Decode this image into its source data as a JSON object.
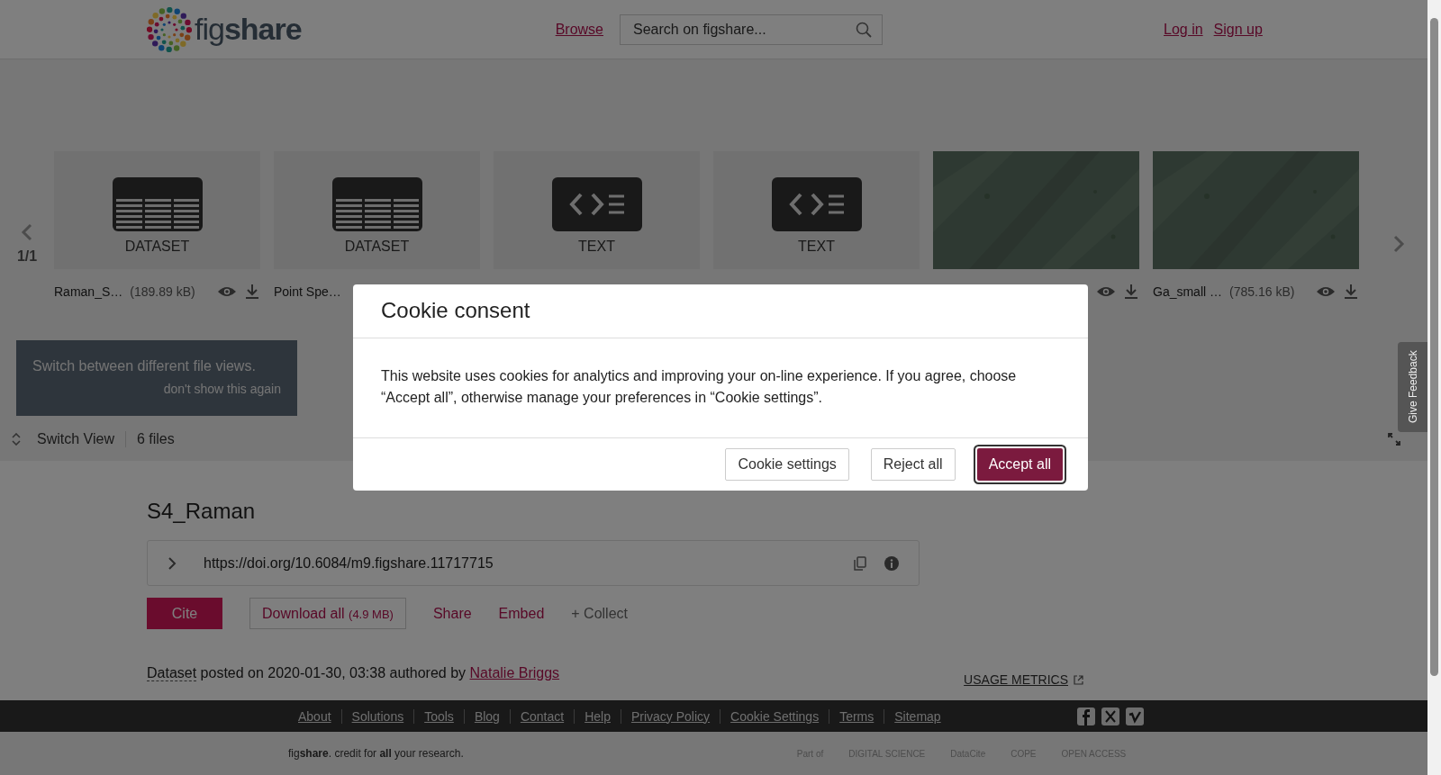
{
  "header": {
    "logo": {
      "light": "fig",
      "bold": "share"
    },
    "browse": "Browse",
    "search": {
      "placeholder": "Search on figshare..."
    },
    "login": "Log in",
    "signup": "Sign up"
  },
  "gallery": {
    "page": "1/1",
    "cards": [
      {
        "kind": "dataset",
        "label": "DATASET",
        "name": "Raman_S…",
        "size": "(189.89 kB)",
        "actions": [
          {
            "kind": "view"
          },
          {
            "kind": "download"
          }
        ]
      },
      {
        "kind": "dataset",
        "label": "DATASET",
        "name": "Point Spe…"
      },
      {
        "kind": "text",
        "label": "TEXT"
      },
      {
        "kind": "text",
        "label": "TEXT"
      },
      {
        "kind": "picture",
        "actions": [
          {
            "kind": "view"
          },
          {
            "kind": "download"
          }
        ]
      },
      {
        "kind": "picture",
        "name": "Ga_small …",
        "size": "(785.16 kB)",
        "actions": [
          {
            "kind": "view"
          },
          {
            "kind": "download"
          }
        ]
      }
    ],
    "tooltip": {
      "text": "Switch between different file views.",
      "dismiss": "don't show this again"
    },
    "switch_view": "Switch View",
    "file_count": "6 files"
  },
  "feedback": "Give Feedback",
  "item": {
    "title": "S4_Raman",
    "doi": "https://doi.org/10.6084/m9.figshare.11717715",
    "cite": "Cite",
    "download": "Download all",
    "download_size": "(4.9 MB)",
    "share": "Share",
    "embed": "Embed",
    "collect": "+ Collect",
    "type": "Dataset",
    "posted": "posted on 2020-01-30, 03:38 authored by",
    "author": "Natalie Briggs",
    "metrics": "USAGE METRICS"
  },
  "footer": {
    "links": [
      "About",
      "Solutions",
      "Tools",
      "Blog",
      "Contact",
      "Help",
      "Privacy Policy",
      "Cookie Settings",
      "Terms",
      "Sitemap"
    ],
    "tagline": "fig**share**. credit for **all** your research.",
    "partners": [
      "Part of",
      "DIGITAL SCIENCE",
      "DataCite",
      "COPE",
      "OPEN ACCESS"
    ]
  },
  "cookie_modal": {
    "title": "Cookie consent",
    "body": "This website uses cookies for analytics and improving your on-line experience. If you agree, choose “Accept all”, otherwise manage your preferences in “Cookie settings”.",
    "buttons": [
      {
        "label": "Cookie settings",
        "kind": "secondary"
      },
      {
        "label": "Reject all",
        "kind": "secondary"
      },
      {
        "label": "Accept all",
        "kind": "primary"
      }
    ]
  }
}
